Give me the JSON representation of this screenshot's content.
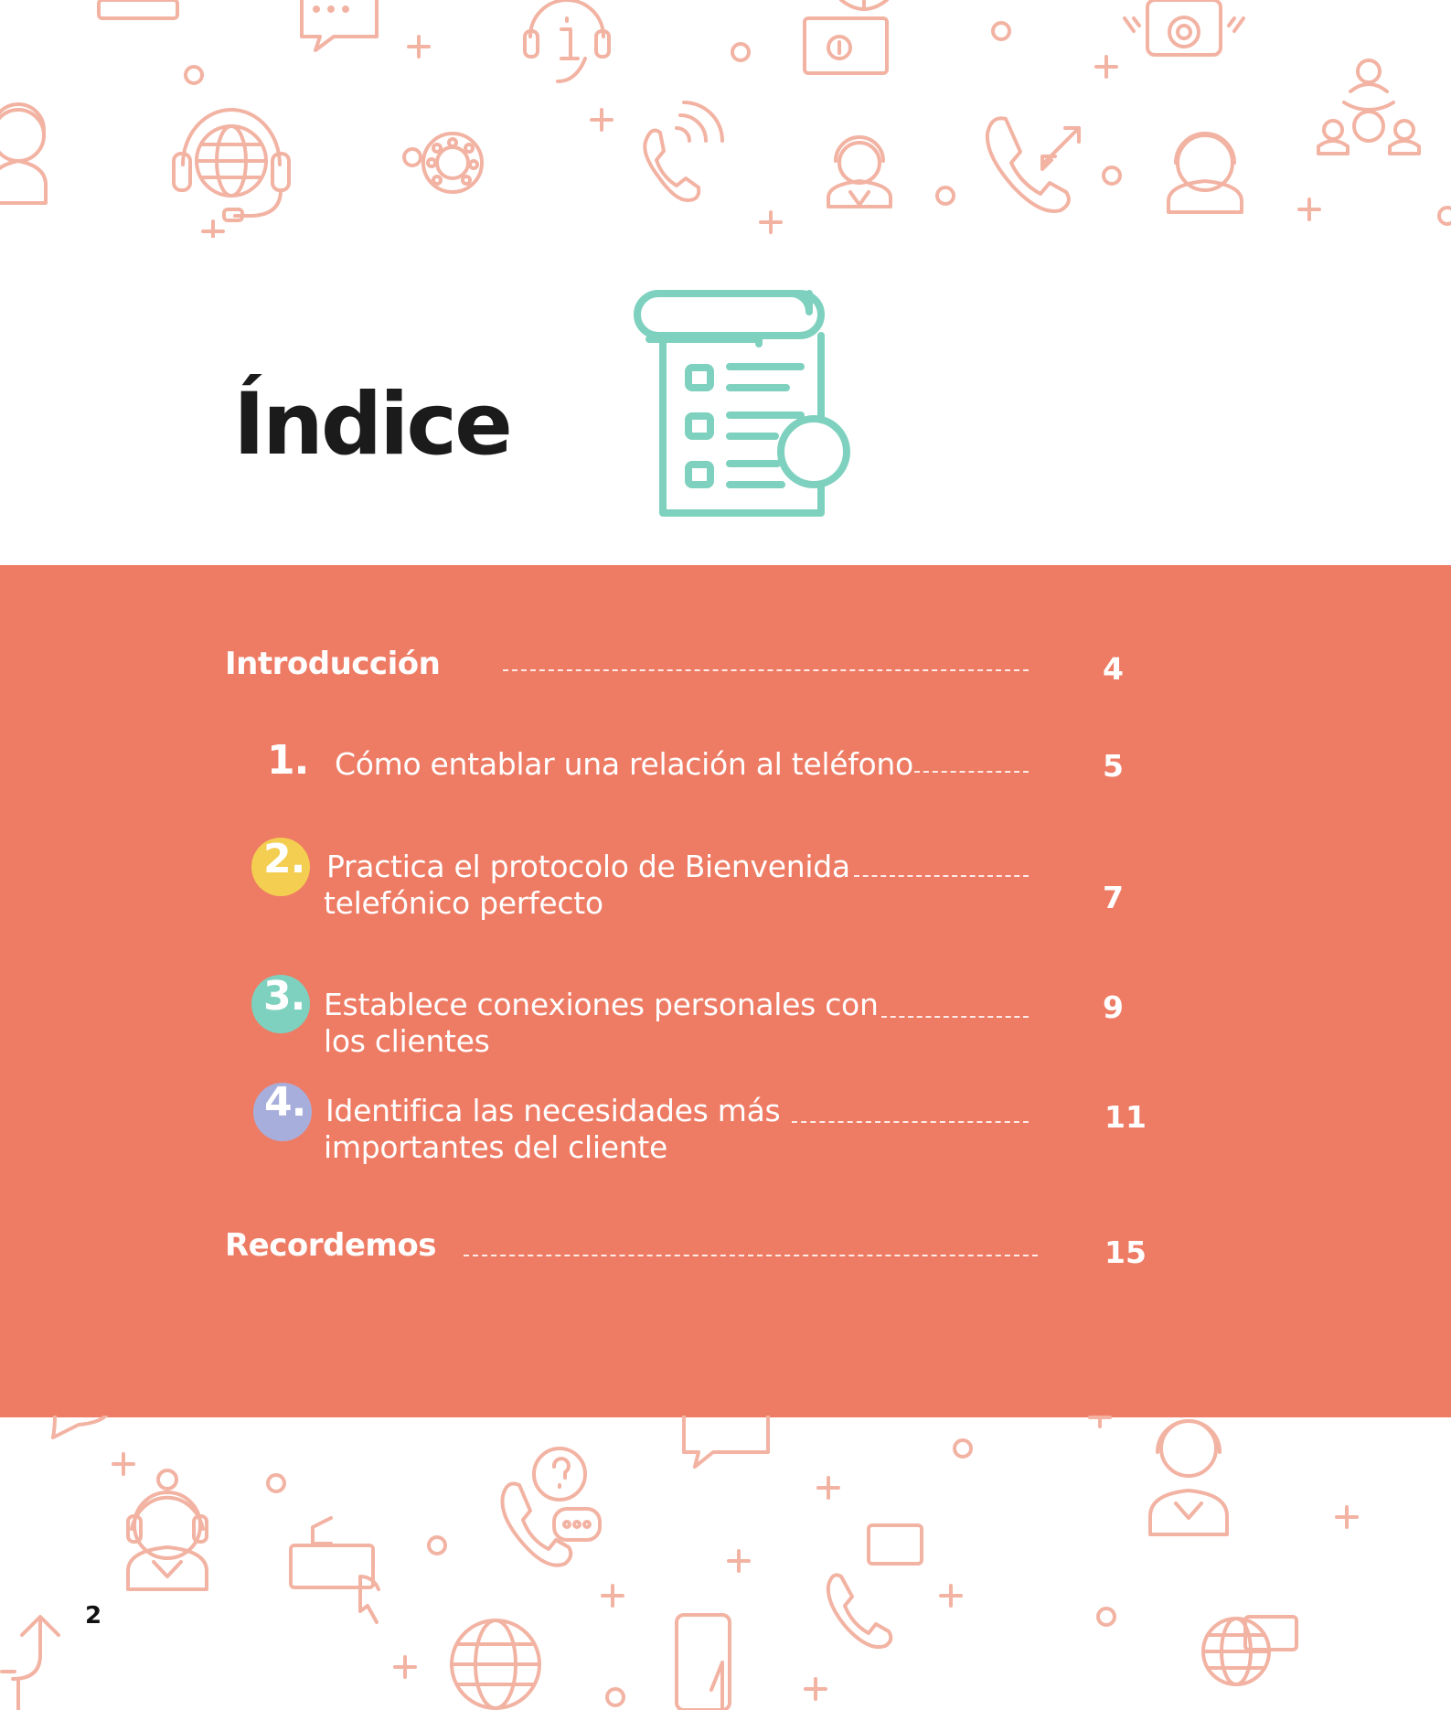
{
  "page": {
    "title": "Índice",
    "page_number": "2"
  },
  "colors": {
    "band": "#ee7b64",
    "icon_pattern": "#f2b3a3",
    "title_icon": "#7fd1bf",
    "badge_1": "#ee7b64",
    "badge_2": "#f3ce50",
    "badge_3": "#7fd1bf",
    "badge_4": "#a8aedb"
  },
  "icons": {
    "title": "document-checklist-icon",
    "pattern": [
      "headset-agent-icon",
      "globe-headset-icon",
      "chat-bubble-icon",
      "info-headset-icon",
      "phone-ringing-icon",
      "rotary-dial-24-7-icon",
      "call-transfer-icon",
      "network-people-icon",
      "telephone-icon",
      "info-sign-icon",
      "mobile-phone-icon",
      "24h-call-icon"
    ]
  },
  "toc": {
    "intro": {
      "label": "Introducción",
      "page": "4"
    },
    "items": [
      {
        "number": "1.",
        "lines": [
          "Cómo entablar una relación al teléfono"
        ],
        "page": "5"
      },
      {
        "number": "2.",
        "lines": [
          "Practica el protocolo de Bienvenida",
          "telefónico perfecto"
        ],
        "page": "7"
      },
      {
        "number": "3.",
        "lines": [
          "Establece conexiones personales con",
          "los clientes"
        ],
        "page": "9"
      },
      {
        "number": "4.",
        "lines": [
          "Identifica las necesidades más",
          "importantes del cliente"
        ],
        "page": "11"
      }
    ],
    "closing": {
      "label": "Recordemos",
      "page": "15"
    }
  }
}
